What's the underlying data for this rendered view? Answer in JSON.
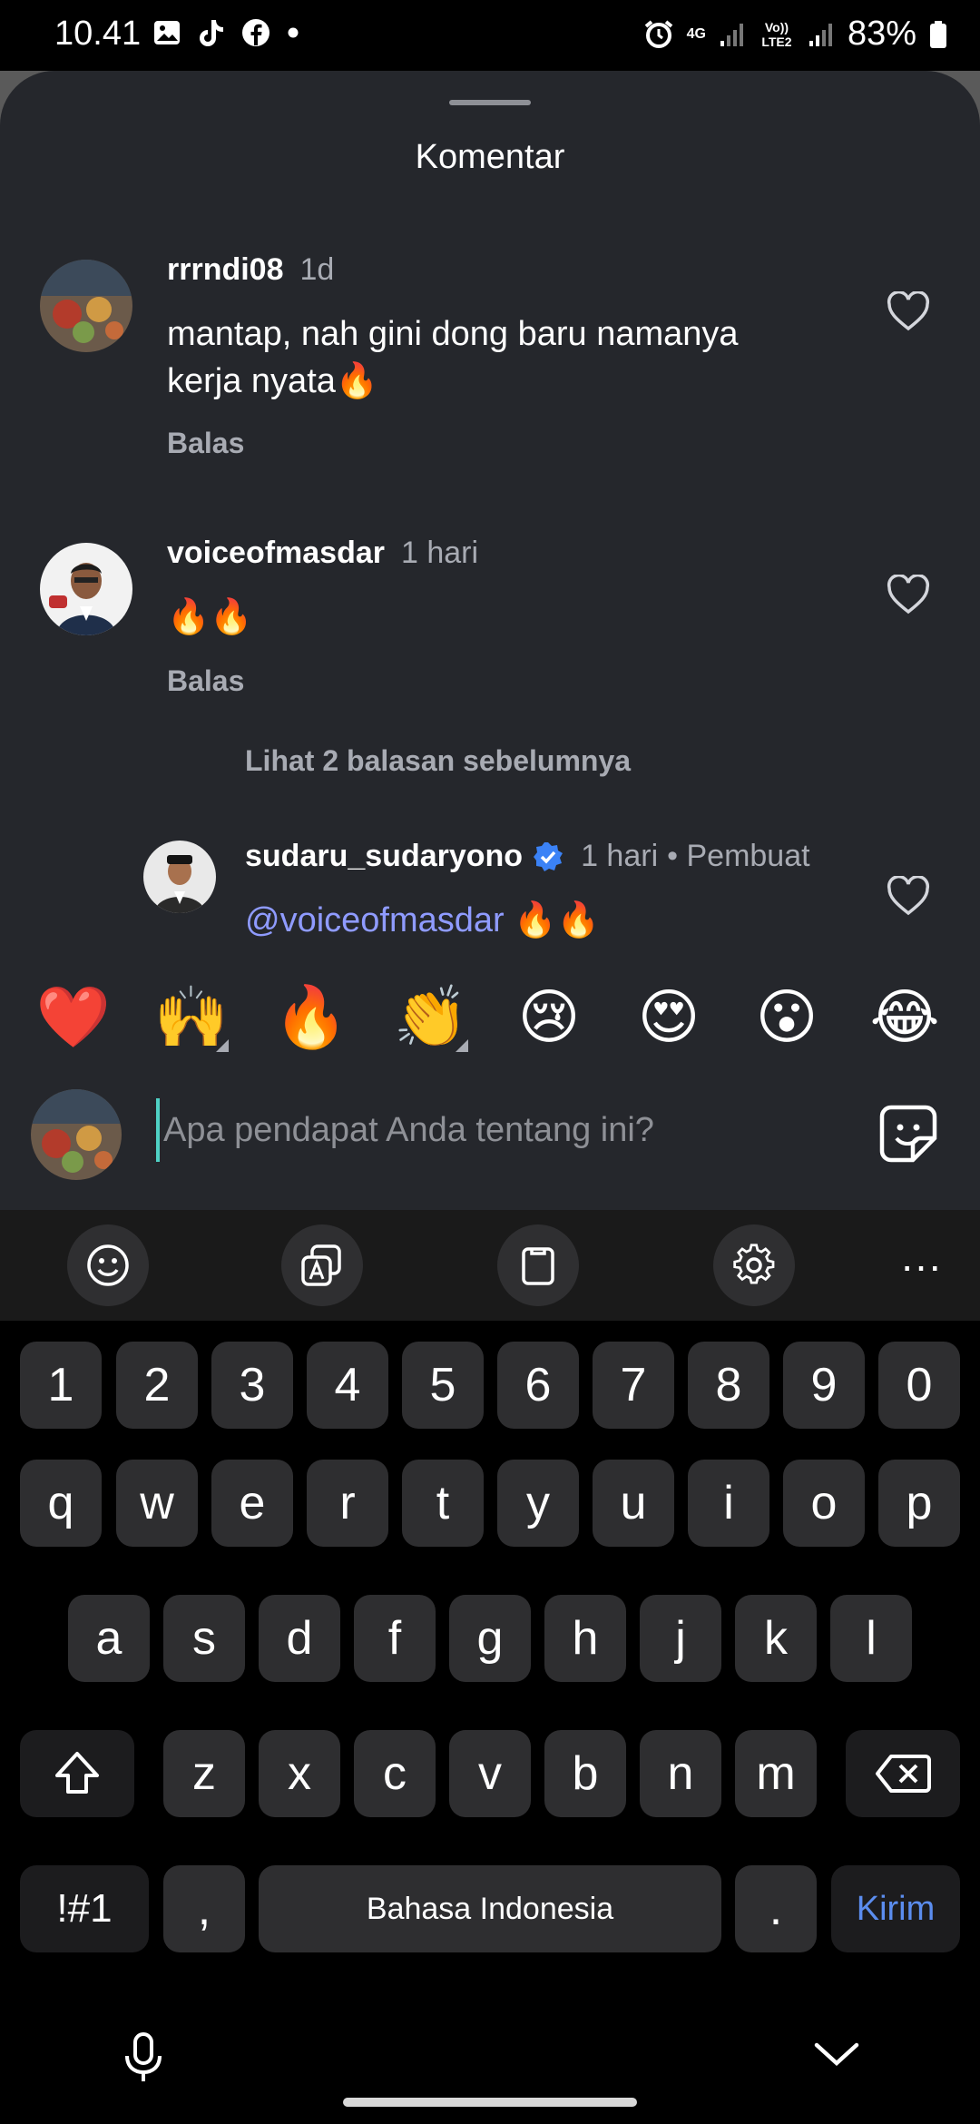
{
  "status_bar": {
    "time": "10.41",
    "network_top": "4G",
    "network_label": "Vo)) LTE2",
    "battery": "83%"
  },
  "sheet": {
    "title": "Komentar"
  },
  "comments": [
    {
      "username": "rrrndi08",
      "time": "1d",
      "text_line1": "mantap, nah gini dong baru namanya",
      "text_line2": "kerja nyata🔥",
      "reply_label": "Balas"
    },
    {
      "username": "voiceofmasdar",
      "time": "1 hari",
      "text": "🔥🔥",
      "reply_label": "Balas"
    }
  ],
  "view_replies": "Lihat 2 balasan sebelumnya",
  "reply_comment": {
    "username": "sudaru_sudaryono",
    "time": "1 hari",
    "creator_label": "• Pembuat",
    "mention": "@voiceofmasdar",
    "text": "🔥🔥"
  },
  "reactions": [
    "❤️",
    "🙌",
    "🔥",
    "👏",
    "😢",
    "😍",
    "😮",
    "😂"
  ],
  "input": {
    "placeholder": "Apa pendapat Anda tentang ini?"
  },
  "keyboard": {
    "row_numbers": [
      "1",
      "2",
      "3",
      "4",
      "5",
      "6",
      "7",
      "8",
      "9",
      "0"
    ],
    "row_1": [
      "q",
      "w",
      "e",
      "r",
      "t",
      "y",
      "u",
      "i",
      "o",
      "p"
    ],
    "row_2": [
      "a",
      "s",
      "d",
      "f",
      "g",
      "h",
      "j",
      "k",
      "l"
    ],
    "row_3": [
      "z",
      "x",
      "c",
      "v",
      "b",
      "n",
      "m"
    ],
    "symbols_key": "!#1",
    "comma_key": ",",
    "space_key": "Bahasa Indonesia",
    "period_key": ".",
    "send_key": "Kirim",
    "more_label": "···"
  },
  "colors": {
    "sheet_bg": "#25272c",
    "mention": "#8f9bff",
    "send_key": "#5b8def",
    "verified": "#3b82f6"
  }
}
